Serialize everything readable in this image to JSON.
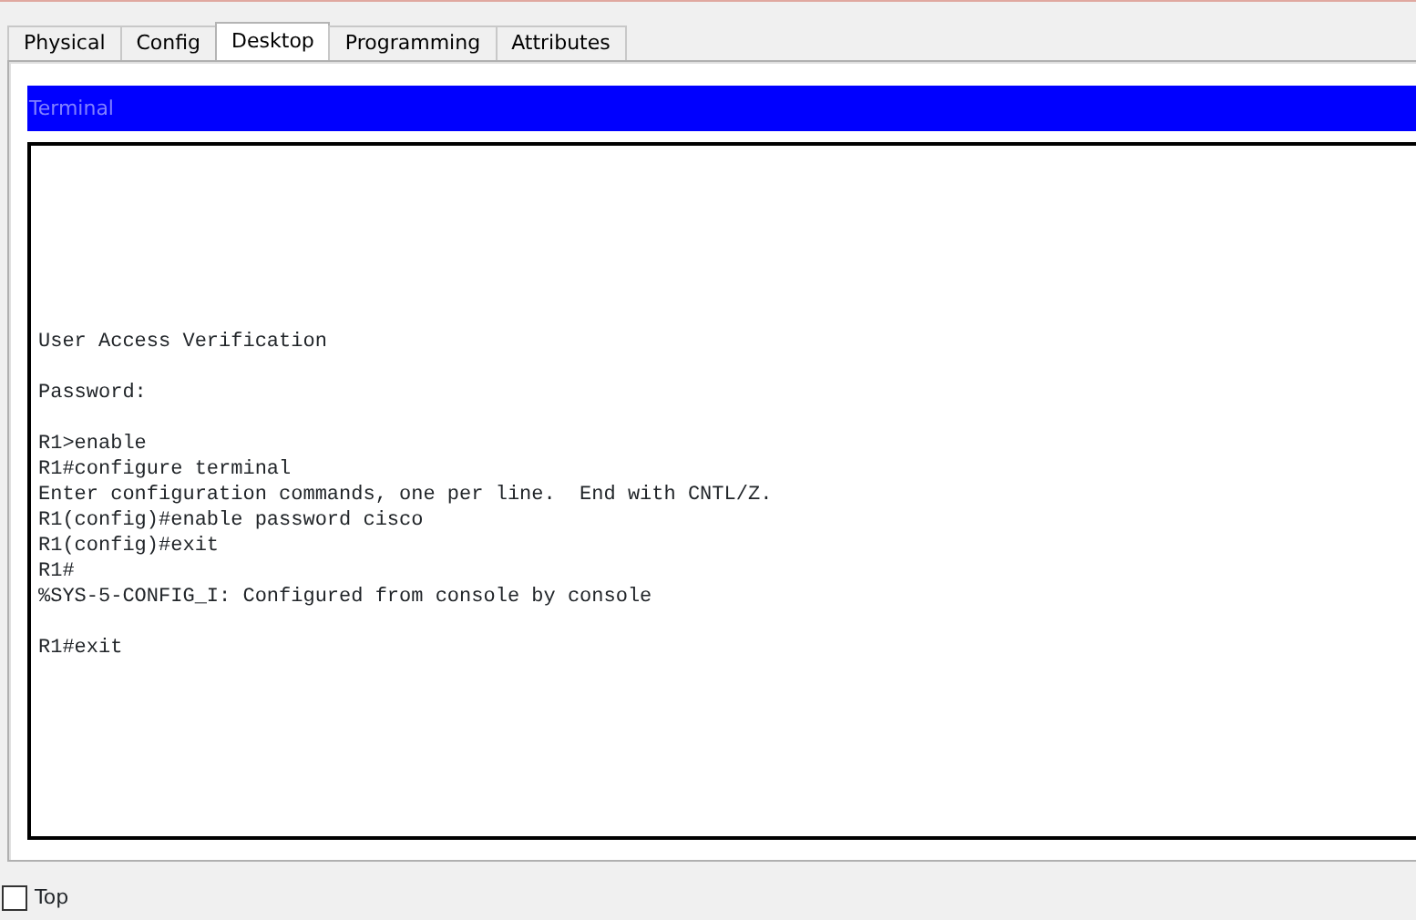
{
  "tabs": [
    {
      "label": "Physical",
      "selected": false
    },
    {
      "label": "Config",
      "selected": false
    },
    {
      "label": "Desktop",
      "selected": true
    },
    {
      "label": "Programming",
      "selected": false
    },
    {
      "label": "Attributes",
      "selected": false
    }
  ],
  "terminal": {
    "title": "Terminal",
    "paragraphs": [
      [
        "User Access Verification"
      ],
      [
        "Password:"
      ],
      [
        "R1>enable",
        "R1#configure terminal",
        "Enter configuration commands, one per line.  End with CNTL/Z.",
        "R1(config)#enable password cisco",
        "R1(config)#exit",
        "R1#",
        "%SYS-5-CONFIG_I: Configured from console by console"
      ],
      [
        "R1#exit"
      ]
    ]
  },
  "top_checkbox": {
    "label": "Top",
    "checked": false
  }
}
